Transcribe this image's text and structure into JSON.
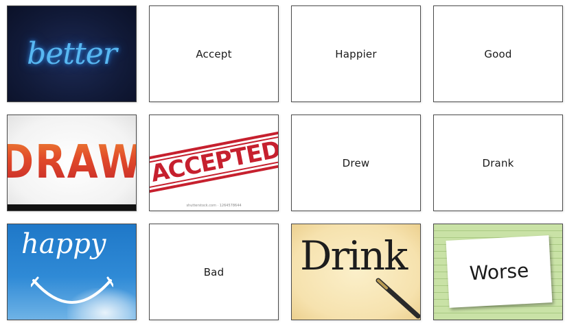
{
  "cards": [
    {
      "type": "image",
      "image_text": "better"
    },
    {
      "type": "text",
      "label": "Accept"
    },
    {
      "type": "text",
      "label": "Happier"
    },
    {
      "type": "text",
      "label": "Good"
    },
    {
      "type": "image",
      "image_text": "DRAW"
    },
    {
      "type": "image",
      "image_text": "ACCEPTED",
      "credit": "shutterstock.com · 1264578644"
    },
    {
      "type": "text",
      "label": "Drew"
    },
    {
      "type": "text",
      "label": "Drank"
    },
    {
      "type": "image",
      "image_text": "happy"
    },
    {
      "type": "text",
      "label": "Bad"
    },
    {
      "type": "image",
      "image_text": "Drink"
    },
    {
      "type": "image",
      "image_text": "Worse"
    }
  ],
  "colors": {
    "card_border": "#4a4a4a",
    "neon_blue": "#58b8f2",
    "stamp_red": "#c6202e",
    "sky_blue": "#1f78c8",
    "paper_green": "#c9e2a6"
  }
}
